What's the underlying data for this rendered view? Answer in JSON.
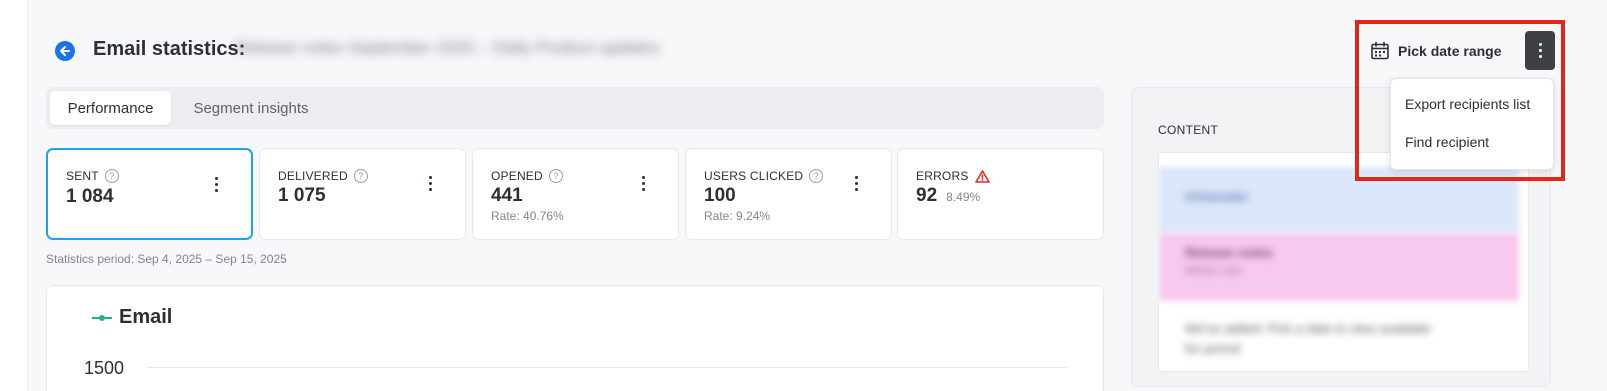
{
  "header": {
    "title": "Email statistics:",
    "campaign_name": "Release notes September 2025 – Daily Product updates"
  },
  "tabs": [
    {
      "label": "Performance",
      "active": true
    },
    {
      "label": "Segment insights",
      "active": false
    }
  ],
  "metrics": {
    "sent": {
      "label": "SENT",
      "value": "1 084"
    },
    "delivered": {
      "label": "DELIVERED",
      "value": "1 075"
    },
    "opened": {
      "label": "OPENED",
      "value": "441",
      "rate": "Rate: 40.76%"
    },
    "users_clicked": {
      "label": "USERS CLICKED",
      "value": "100",
      "rate": "Rate: 9.24%"
    },
    "errors": {
      "label": "ERRORS",
      "value": "92",
      "rate": "8.49%"
    }
  },
  "help_glyph": "?",
  "statistics_period": "Statistics period: Sep 4, 2025 – Sep 15, 2025",
  "chart": {
    "legend": "Email",
    "y_tick": "1500"
  },
  "chart_data": {
    "type": "line",
    "series": [
      {
        "name": "Email",
        "values": []
      }
    ],
    "ylabel": "",
    "yticks": [
      "1500"
    ]
  },
  "content_panel": {
    "label": "CONTENT",
    "preview_lines": [
      "Unisender",
      "Release notes",
      "What's new",
      "We've added: Pick a date to view available",
      "for period"
    ]
  },
  "toolbar": {
    "date_range_label": "Pick date range"
  },
  "menu": {
    "items": [
      "Export recipients list",
      "Find recipient"
    ]
  },
  "colors": {
    "accent": "#1a73e8",
    "selected_card_border": "#1ea2e8",
    "error": "#d93025",
    "legend_line": "#1fb38a",
    "highlight": "#e02718"
  }
}
